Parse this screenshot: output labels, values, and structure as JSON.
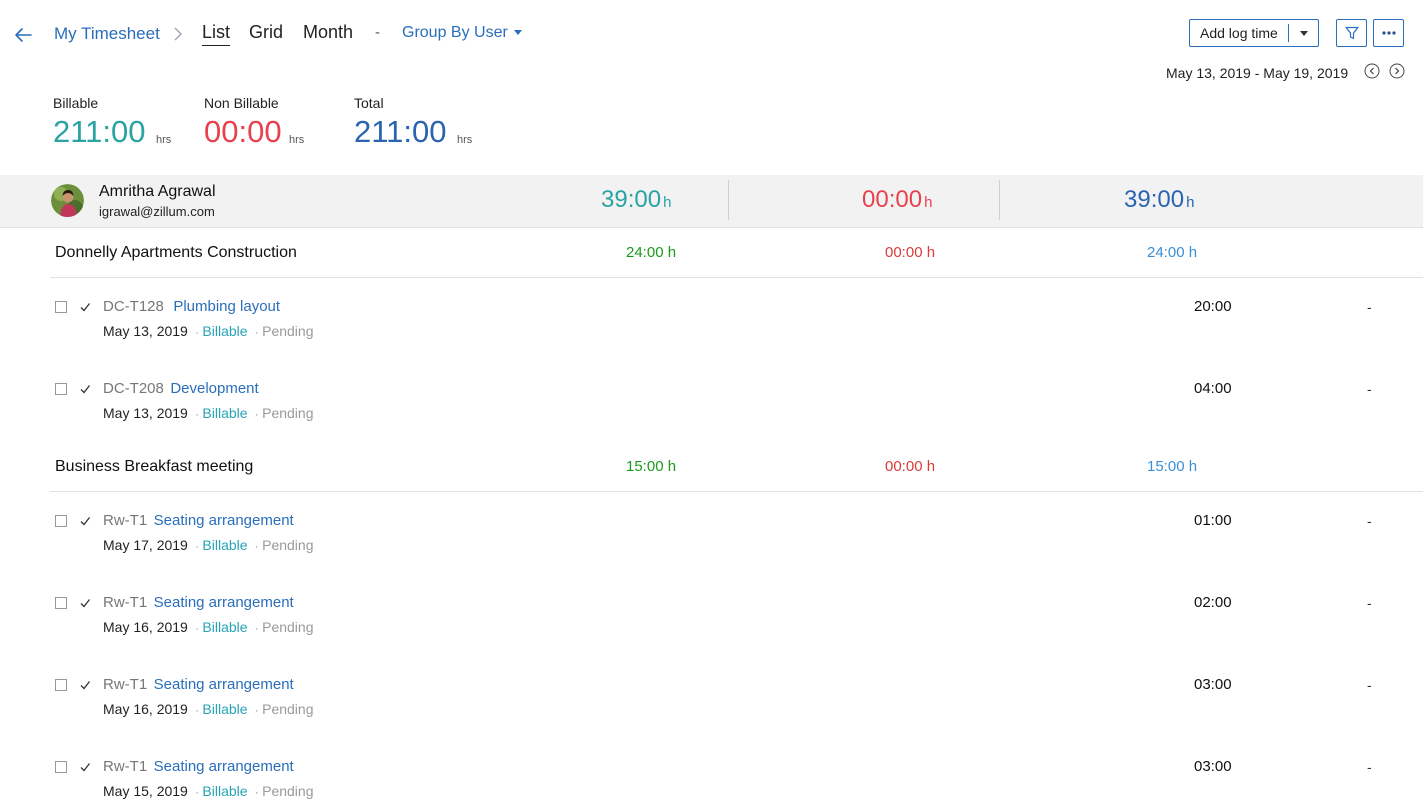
{
  "header": {
    "breadcrumb": "My Timesheet",
    "tabs": [
      "List",
      "Grid",
      "Month"
    ],
    "separator": "-",
    "group_by": "Group By User",
    "add_log_label": "Add log time",
    "date_range": "May 13, 2019 - May 19, 2019"
  },
  "summary": {
    "billable_label": "Billable",
    "billable_value": "211:00",
    "nonbillable_label": "Non Billable",
    "nonbillable_value": "00:00",
    "total_label": "Total",
    "total_value": "211:00",
    "unit": "hrs"
  },
  "user": {
    "name": "Amritha Agrawal",
    "email": "igrawal@zillum.com",
    "billable": "39:00",
    "nonbillable": "00:00",
    "total": "39:00",
    "unit": "h"
  },
  "colors": {
    "billable": "#2aa3a3",
    "nonbillable": "#e8414e",
    "total": "#2a64b0",
    "link": "#2a6ebb",
    "project_billable": "#1a9a1a",
    "project_nonbillable": "#d93b3b",
    "project_total": "#3a8ed6"
  },
  "projects": [
    {
      "name": "Donnelly Apartments Construction",
      "billable": "24:00 h",
      "nonbillable": "00:00 h",
      "total": "24:00 h",
      "entries": [
        {
          "code": "DC-T128",
          "task": "Plumbing layout",
          "date": "May 13, 2019",
          "billing": "Billable",
          "status": "Pending",
          "hours": "20:00",
          "approval": "-"
        },
        {
          "code": "DC-T208",
          "task": "Development",
          "date": "May 13, 2019",
          "billing": "Billable",
          "status": "Pending",
          "hours": "04:00",
          "approval": "-"
        }
      ]
    },
    {
      "name": "Business Breakfast meeting",
      "billable": "15:00 h",
      "nonbillable": "00:00 h",
      "total": "15:00 h",
      "entries": [
        {
          "code": "Rw-T1",
          "task": "Seating arrangement",
          "date": "May 17, 2019",
          "billing": "Billable",
          "status": "Pending",
          "hours": "01:00",
          "approval": "-"
        },
        {
          "code": "Rw-T1",
          "task": "Seating arrangement",
          "date": "May 16, 2019",
          "billing": "Billable",
          "status": "Pending",
          "hours": "02:00",
          "approval": "-"
        },
        {
          "code": "Rw-T1",
          "task": "Seating arrangement",
          "date": "May 16, 2019",
          "billing": "Billable",
          "status": "Pending",
          "hours": "03:00",
          "approval": "-"
        },
        {
          "code": "Rw-T1",
          "task": "Seating arrangement",
          "date": "May 15, 2019",
          "billing": "Billable",
          "status": "Pending",
          "hours": "03:00",
          "approval": "-"
        }
      ]
    }
  ]
}
